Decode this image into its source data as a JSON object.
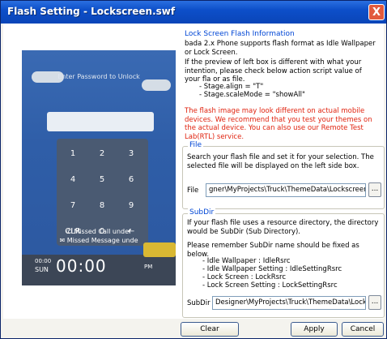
{
  "window": {
    "title": "Flash Setting - Lockscreen.swf",
    "close_label": "X"
  },
  "phone": {
    "unlock_prompt": "Enter Password to Unlock",
    "keys": [
      "1",
      "2",
      "3",
      "4",
      "5",
      "6",
      "7",
      "8",
      "9",
      "CLR",
      "0",
      "←"
    ],
    "missed_call": "Missed Call  undef",
    "missed_message": "Missed Message  unde",
    "clock_ampm_top": "00:00",
    "clock_day": "SUN",
    "clock_time": "00:00",
    "clock_pm": "PM"
  },
  "info_group": {
    "title": "Lock Screen Flash Information",
    "line1": "bada 2.x Phone supports flash format as Idle Wallpaper or Lock Screen.",
    "line2": "If the preview of left box is different with what your intention, please check below action script value of your fla or as file.",
    "stage_align": "- Stage.align = \"T\"",
    "stage_scale": "- Stage.scaleMode = \"showAll\"",
    "warning": "The flash image may look different on actual mobile devices. We recommend that you test your themes on the actual device. You can also use our Remote Test Lab(RTL) service."
  },
  "file_group": {
    "title": "File",
    "description": "Search your flash file and set it for your selection. The selected file will be displayed on the left side box.",
    "label": "File",
    "value": "gner\\MyProjects\\Truck\\ThemeData\\Lockscreen.swf",
    "browse_label": "..."
  },
  "subdir_group": {
    "title": "SubDir",
    "description": "If your flash file uses a resource directory, the directory would be SubDir (Sub Directory).",
    "note": "Please remember SubDir name should be fixed as below.",
    "items": [
      "- Idle Wallpaper : IdleRsrc",
      "- Idle Wallpaper Setting : IdleSettingRsrc",
      "- Lock Screen : LockRsrc",
      "- Lock Screen Setting : LockSettingRsrc"
    ],
    "label": "SubDir",
    "value": "Designer\\MyProjects\\Truck\\ThemeData\\LockRsrc",
    "browse_label": "..."
  },
  "buttons": {
    "clear": "Clear",
    "apply": "Apply",
    "cancel": "Cancel"
  }
}
